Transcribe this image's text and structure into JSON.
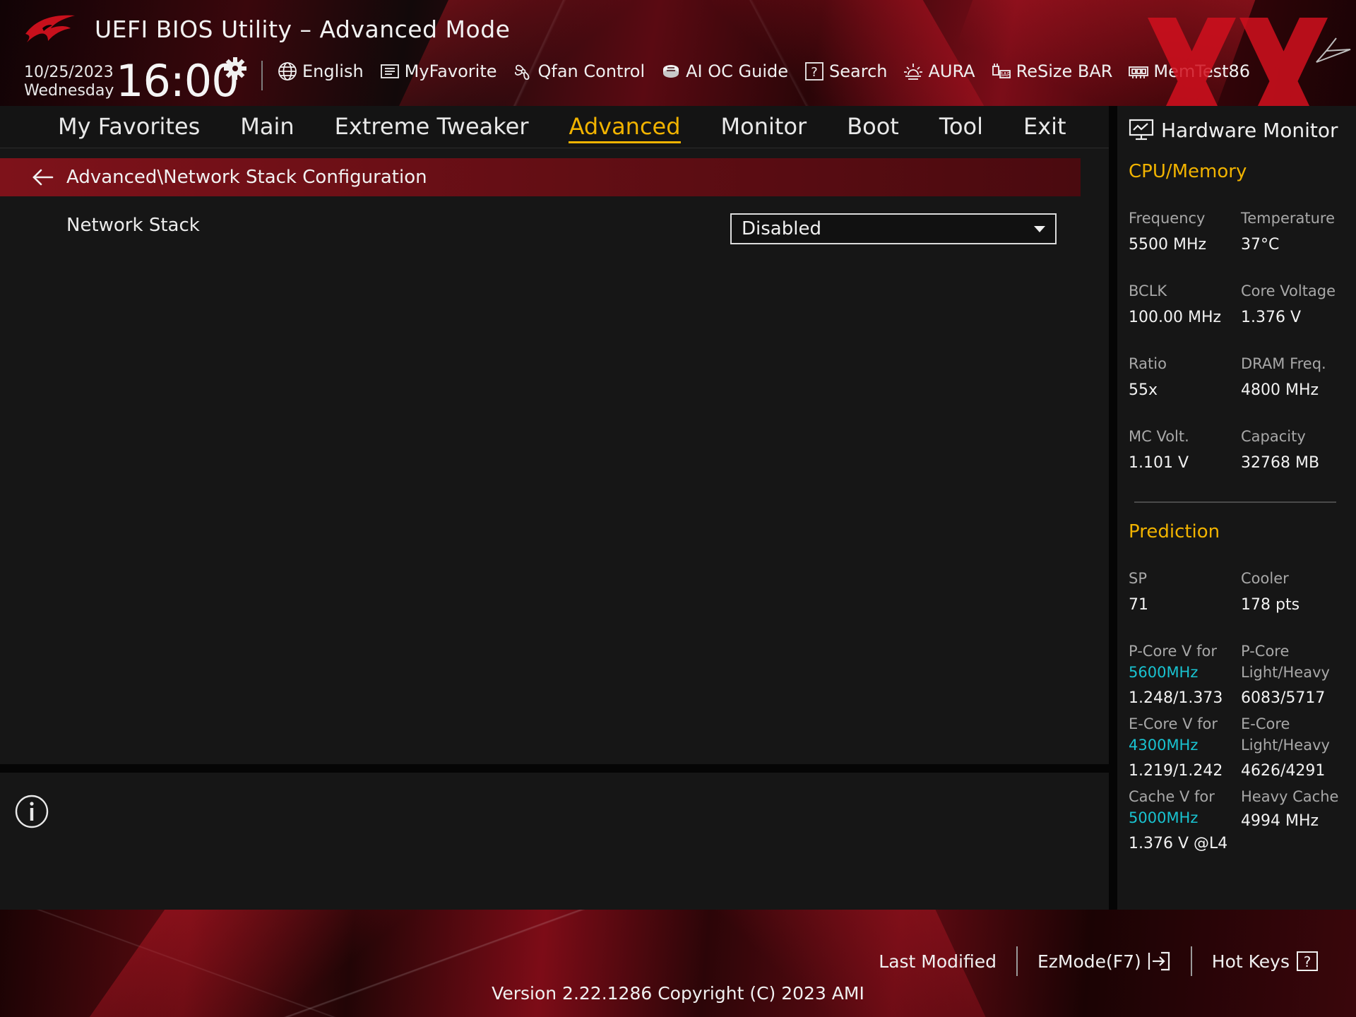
{
  "header": {
    "title": "UEFI BIOS Utility – Advanced Mode",
    "date": "10/25/2023",
    "day": "Wednesday",
    "time": "16:00",
    "tools": [
      {
        "label": "English",
        "icon": "globe-icon"
      },
      {
        "label": "MyFavorite",
        "icon": "favorite-list-icon"
      },
      {
        "label": "Qfan Control",
        "icon": "fan-icon"
      },
      {
        "label": "AI OC Guide",
        "icon": "ai-chip-icon"
      },
      {
        "label": "Search",
        "icon": "question-box-icon"
      },
      {
        "label": "AURA",
        "icon": "aura-light-icon"
      },
      {
        "label": "ReSize BAR",
        "icon": "resize-bar-icon"
      },
      {
        "label": "MemTest86",
        "icon": "memory-icon"
      }
    ]
  },
  "menu": {
    "tabs": [
      "My Favorites",
      "Main",
      "Extreme Tweaker",
      "Advanced",
      "Monitor",
      "Boot",
      "Tool",
      "Exit"
    ],
    "active": "Advanced"
  },
  "main": {
    "breadcrumb": "Advanced\\Network Stack Configuration",
    "settings": [
      {
        "label": "Network Stack",
        "value": "Disabled"
      }
    ]
  },
  "hardware_monitor": {
    "title": "Hardware Monitor",
    "cpu_memory": {
      "heading": "CPU/Memory",
      "frequency_label": "Frequency",
      "frequency": "5500 MHz",
      "temperature_label": "Temperature",
      "temperature": "37°C",
      "bclk_label": "BCLK",
      "bclk": "100.00 MHz",
      "core_voltage_label": "Core Voltage",
      "core_voltage": "1.376 V",
      "ratio_label": "Ratio",
      "ratio": "55x",
      "dram_freq_label": "DRAM Freq.",
      "dram_freq": "4800 MHz",
      "mc_volt_label": "MC Volt.",
      "mc_volt": "1.101 V",
      "capacity_label": "Capacity",
      "capacity": "32768 MB"
    },
    "prediction": {
      "heading": "Prediction",
      "sp_label": "SP",
      "sp": "71",
      "cooler_label": "Cooler",
      "cooler": "178 pts",
      "pcore_v_label": "P-Core V for",
      "pcore_v_freq": "5600MHz",
      "pcore_v": "1.248/1.373",
      "pcore_lh_label_1": "P-Core",
      "pcore_lh_label_2": "Light/Heavy",
      "pcore_lh": "6083/5717",
      "ecore_v_label": "E-Core V for",
      "ecore_v_freq": "4300MHz",
      "ecore_v": "1.219/1.242",
      "ecore_lh_label_1": "E-Core",
      "ecore_lh_label_2": "Light/Heavy",
      "ecore_lh": "4626/4291",
      "cache_v_label": "Cache V for",
      "cache_v_freq": "5000MHz",
      "cache_v": "1.376 V @L4",
      "heavy_cache_label": "Heavy Cache",
      "heavy_cache": "4994 MHz"
    }
  },
  "footer": {
    "last_modified": "Last Modified",
    "ezmode": "EzMode(F7)",
    "hot_keys": "Hot Keys",
    "version": "Version 2.22.1286 Copyright (C) 2023 AMI"
  },
  "colors": {
    "accent": "#f1b300",
    "frequency": "#19c3d0",
    "breadcrumb": "#7e121a"
  }
}
